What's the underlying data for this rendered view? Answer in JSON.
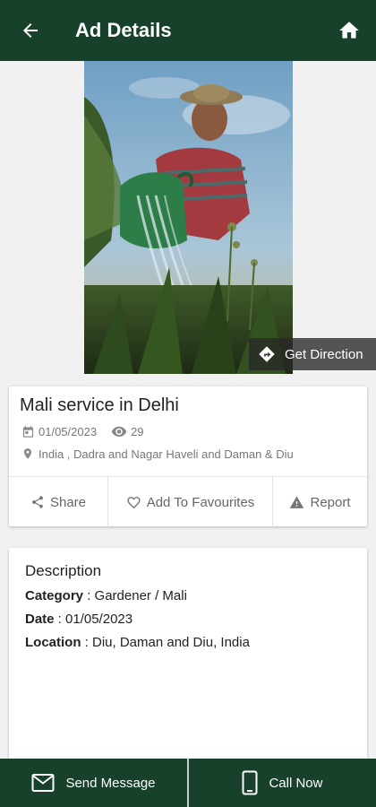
{
  "header": {
    "title": "Ad Details",
    "back_icon": "arrow-left-icon",
    "home_icon": "home-icon",
    "bg_color": "#17412b"
  },
  "image": {
    "get_direction_label": "Get Direction",
    "direction_icon": "direction-diamond-icon"
  },
  "ad": {
    "title": "Mali service in Delhi",
    "date": "01/05/2023",
    "views": "29",
    "location": "India , Dadra and Nagar Haveli and Daman & Diu"
  },
  "actions": {
    "share_label": "Share",
    "favourites_label": "Add To Favourites",
    "report_label": "Report"
  },
  "description": {
    "heading": "Description",
    "category_label": "Category",
    "category_value": " : Gardener / Mali",
    "date_label": "Date",
    "date_value": " : 01/05/2023",
    "location_label": "Location",
    "location_value": " : Diu, Daman and Diu, India"
  },
  "footer": {
    "send_message_label": "Send Message",
    "call_now_label": "Call Now",
    "bg_color": "#17412b"
  }
}
